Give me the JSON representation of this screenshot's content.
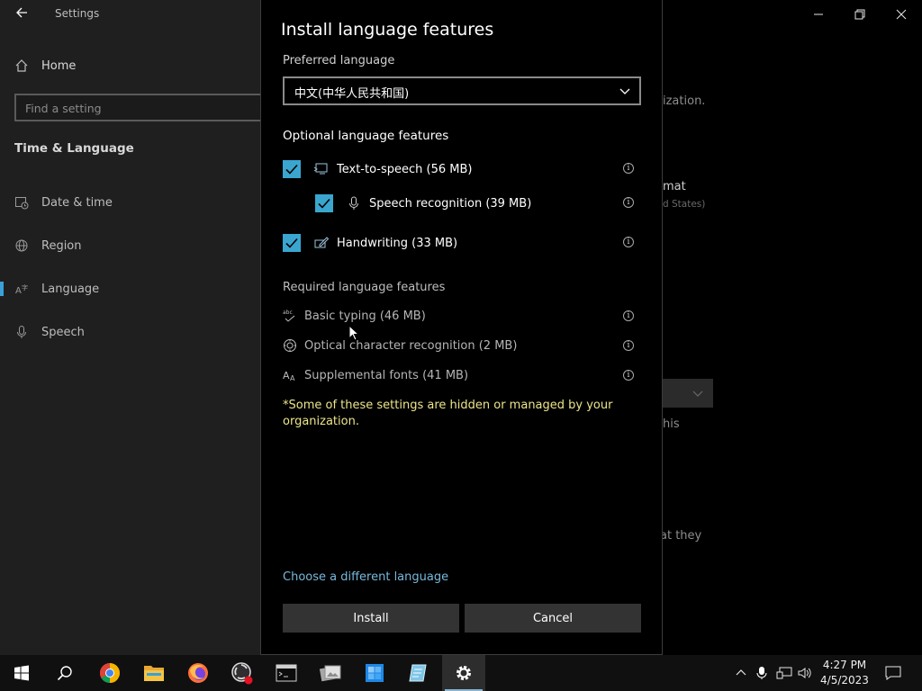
{
  "settings_window": {
    "title": "Settings",
    "home_label": "Home",
    "search_placeholder": "Find a setting",
    "section_title": "Time & Language",
    "nav": [
      {
        "label": "Date & time",
        "icon": "calendar-clock-icon"
      },
      {
        "label": "Region",
        "icon": "globe-icon"
      },
      {
        "label": "Language",
        "icon": "language-icon",
        "active": true
      },
      {
        "label": "Speech",
        "icon": "microphone-icon"
      }
    ],
    "background_fragments": {
      "org": "ization.",
      "format": "mat",
      "states": "d States)",
      "this": "his",
      "they": "at they"
    }
  },
  "dialog": {
    "title": "Install language features",
    "preferred_label": "Preferred language",
    "preferred_value": "中文(中华人民共和国)",
    "optional_heading": "Optional language features",
    "optional_features": [
      {
        "label": "Text-to-speech (56 MB)",
        "checked": true,
        "icon": "text-to-speech-icon"
      },
      {
        "label": "Speech recognition (39 MB)",
        "checked": true,
        "icon": "microphone-icon"
      },
      {
        "label": "Handwriting (33 MB)",
        "checked": true,
        "icon": "handwriting-icon"
      }
    ],
    "required_heading": "Required language features",
    "required_features": [
      {
        "label": "Basic typing (46 MB)",
        "icon": "abc-check-icon"
      },
      {
        "label": "Optical character recognition (2 MB)",
        "icon": "ocr-icon"
      },
      {
        "label": "Supplemental fonts (41 MB)",
        "icon": "font-icon"
      }
    ],
    "note": "*Some of these settings are hidden or managed by your organization.",
    "choose_link": "Choose a different language",
    "install_label": "Install",
    "cancel_label": "Cancel"
  },
  "taskbar": {
    "apps": [
      "start-icon",
      "search-icon",
      "chrome-icon",
      "file-explorer-icon",
      "firefox-icon",
      "obs-icon",
      "terminal-icon",
      "image-viewer-icon",
      "windows-store-icon",
      "notepad-icon",
      "settings-icon"
    ],
    "time": "4:27 PM",
    "date": "4/5/2023"
  },
  "colors": {
    "accent": "#3aa6d0",
    "link": "#78b9dd",
    "note": "#ece58a"
  }
}
